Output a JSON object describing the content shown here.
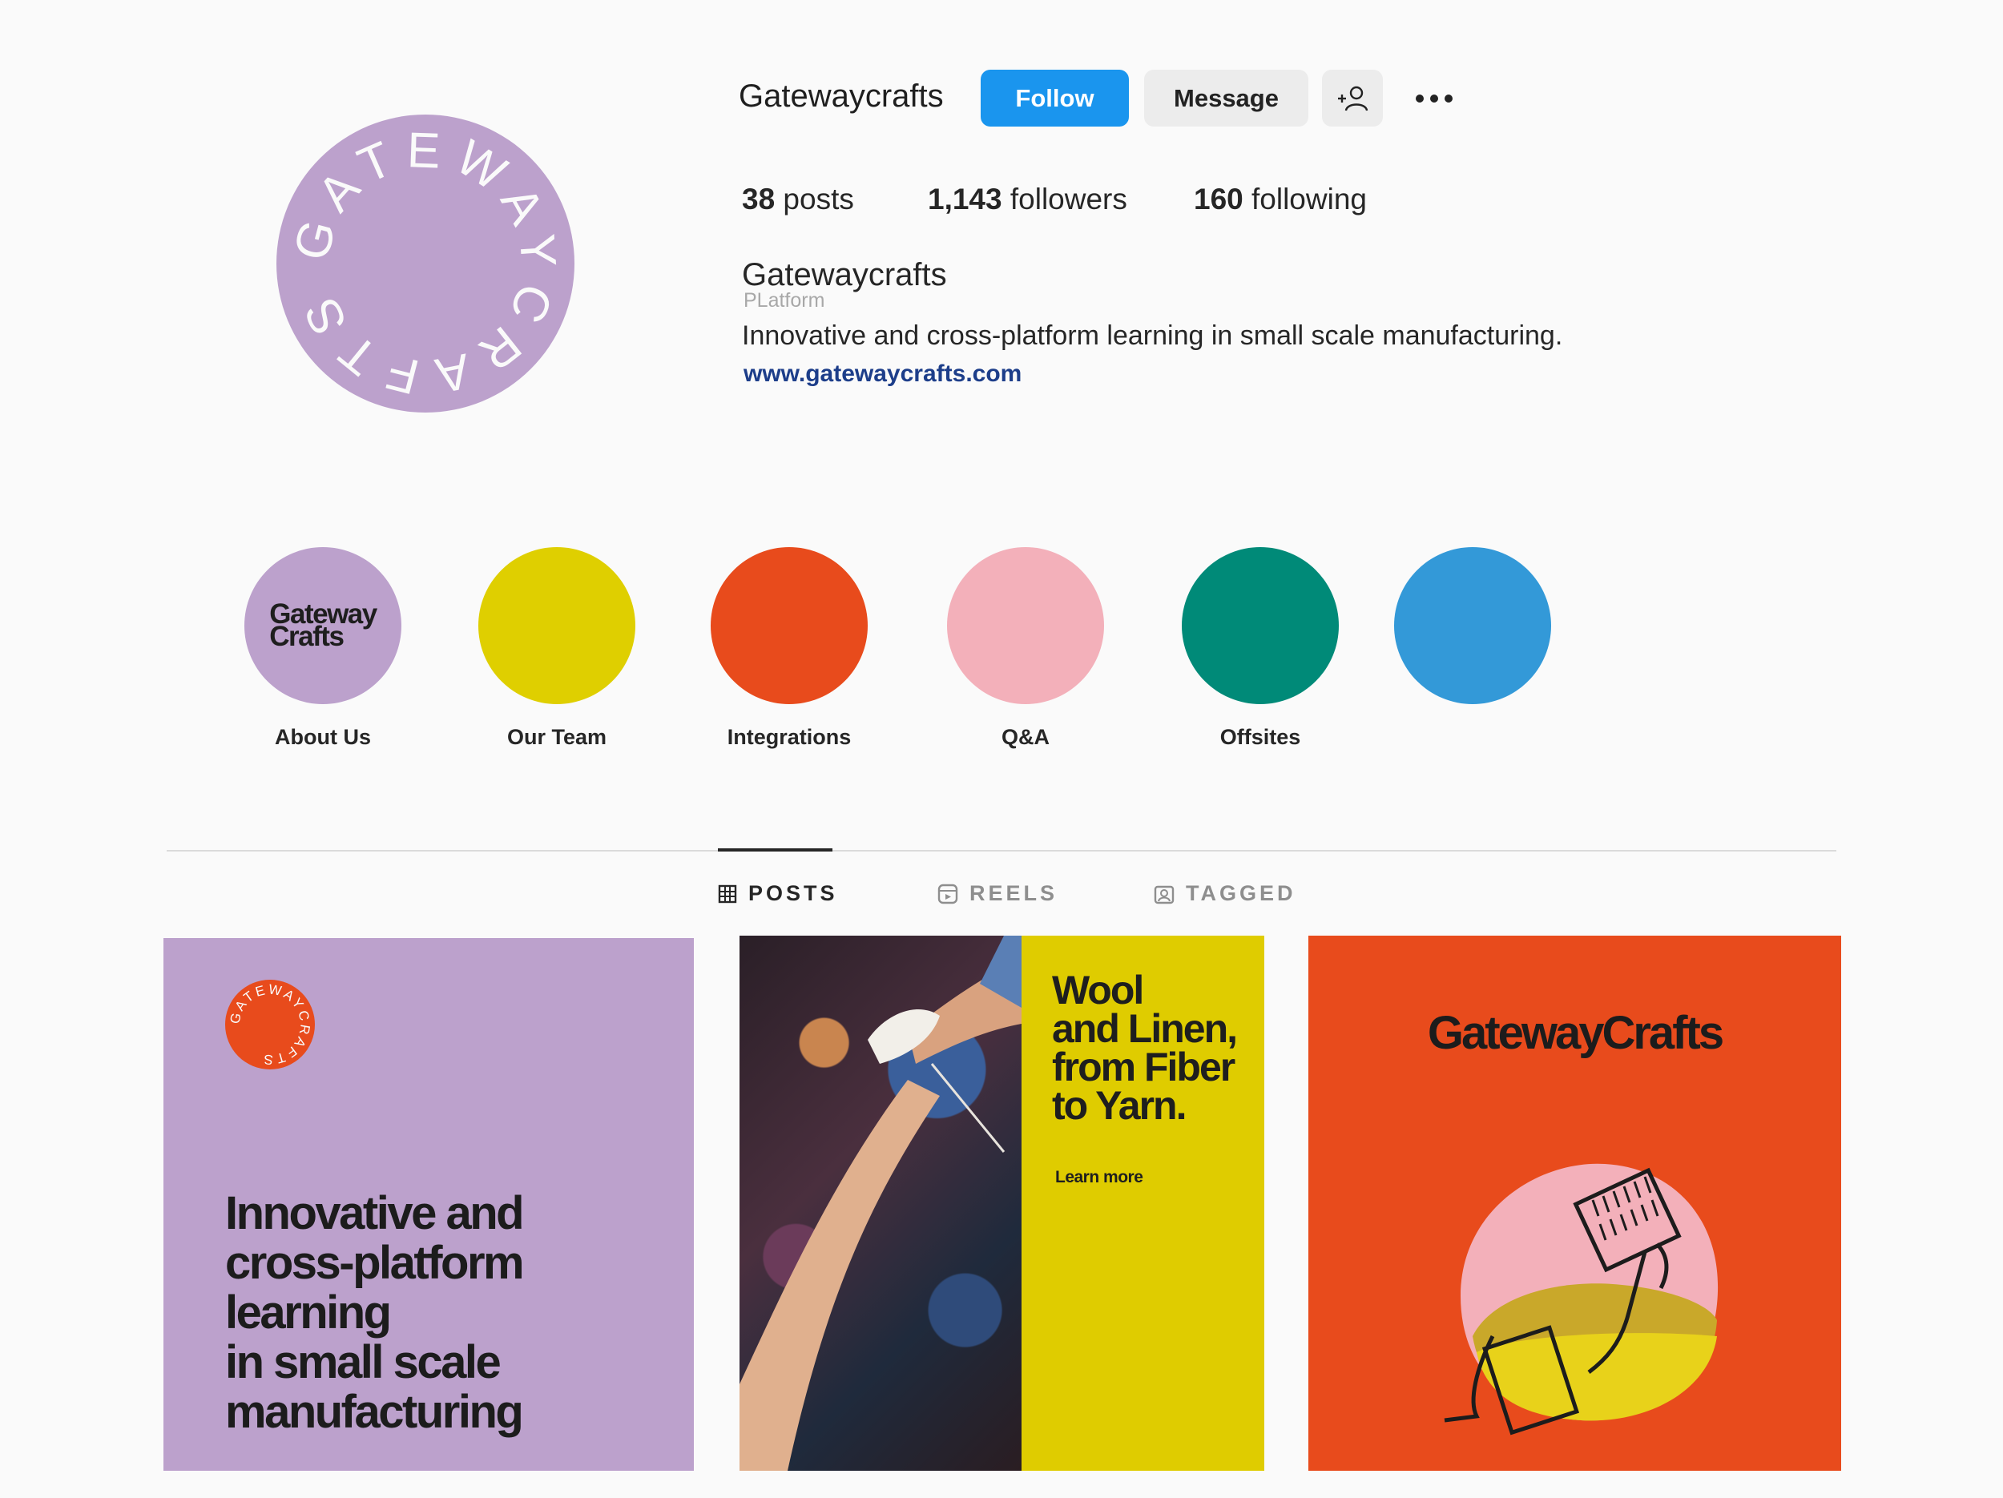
{
  "profile": {
    "username": "Gatewaycrafts",
    "avatar_text": "GATEWAYCRAFTS",
    "follow_label": "Follow",
    "message_label": "Message",
    "add_user_icon": "person-add-icon",
    "more_icon": "more-horizontal-icon",
    "stats": {
      "posts_count": "38",
      "posts_label": " posts",
      "followers_count": "1,143",
      "followers_label": " followers",
      "following_count": "160",
      "following_label": " following"
    },
    "full_name": "Gatewaycrafts",
    "category": "PLatform",
    "bio": "Innovative and cross-platform learning in small scale manufacturing.",
    "website": "www.gatewaycrafts.com"
  },
  "highlights": [
    {
      "label": "About Us",
      "color": "#bca1cc",
      "logo_line1": "Gateway",
      "logo_line2": "Crafts"
    },
    {
      "label": "Our Team",
      "color": "#dfcf00"
    },
    {
      "label": "Integrations",
      "color": "#e84b1c"
    },
    {
      "label": "Q&A",
      "color": "#f3b0ba"
    },
    {
      "label": "Offsites",
      "color": "#008a78"
    },
    {
      "label": "",
      "color": "#3399d8"
    }
  ],
  "tabs": [
    {
      "label": "POSTS",
      "icon": "grid-icon",
      "active": true
    },
    {
      "label": "REELS",
      "icon": "reels-icon",
      "active": false
    },
    {
      "label": "TAGGED",
      "icon": "tagged-icon",
      "active": false
    }
  ],
  "posts": [
    {
      "badge_text": "GATEWAYCRAFTS",
      "lines": [
        "Innovative and",
        "cross-platform",
        "learning",
        "in small scale",
        "manufacturing"
      ],
      "bg": "#bca1cc"
    },
    {
      "title_lines": [
        "Wool",
        "and Linen,",
        "from Fiber",
        "to Yarn."
      ],
      "cta": "Learn more",
      "bg": "#dfcc00"
    },
    {
      "brand": "GatewayCrafts",
      "bg": "#e84b1c"
    }
  ],
  "colors": {
    "accent": "#1a95ee",
    "link": "#1d3e8a"
  }
}
